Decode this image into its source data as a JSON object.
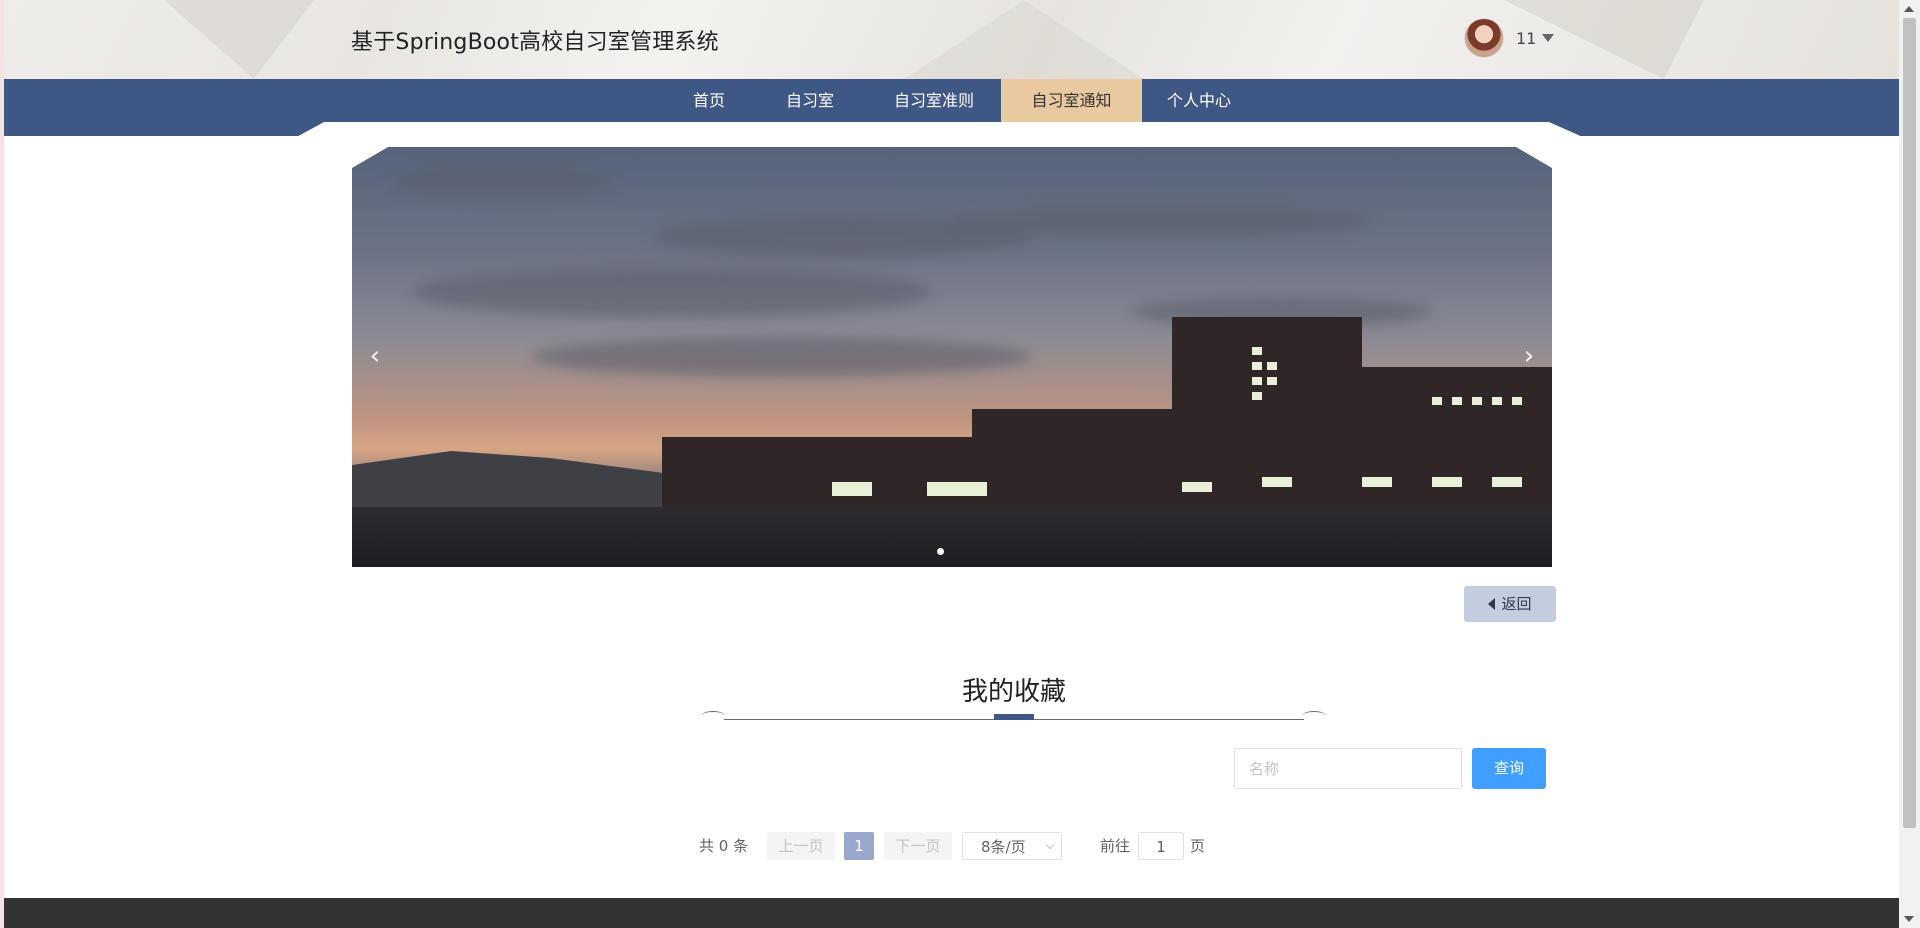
{
  "header": {
    "site_title": "基于SpringBoot高校自习室管理系统",
    "username": "11"
  },
  "nav": {
    "items": [
      {
        "label": "首页"
      },
      {
        "label": "自习室"
      },
      {
        "label": "自习室准则"
      },
      {
        "label": "自习室通知"
      },
      {
        "label": "个人中心"
      }
    ],
    "active_index": 3
  },
  "carousel": {
    "prev_icon": "‹",
    "next_icon": "›",
    "slide_count": 1,
    "active_slide": 0
  },
  "actions": {
    "back_label": "返回"
  },
  "section": {
    "title": "我的收藏"
  },
  "search": {
    "placeholder": "名称",
    "value": "",
    "button_label": "查询"
  },
  "pagination": {
    "total_text": "共 0 条",
    "prev_label": "上一页",
    "current_page": "1",
    "next_label": "下一页",
    "page_size": "8条/页",
    "goto_label": "前往",
    "goto_value": "1",
    "page_suffix": "页"
  },
  "colors": {
    "nav_bg": "#3f5784",
    "nav_active": "#e8c9a0",
    "primary_button": "#409eff",
    "footer": "#333333"
  }
}
